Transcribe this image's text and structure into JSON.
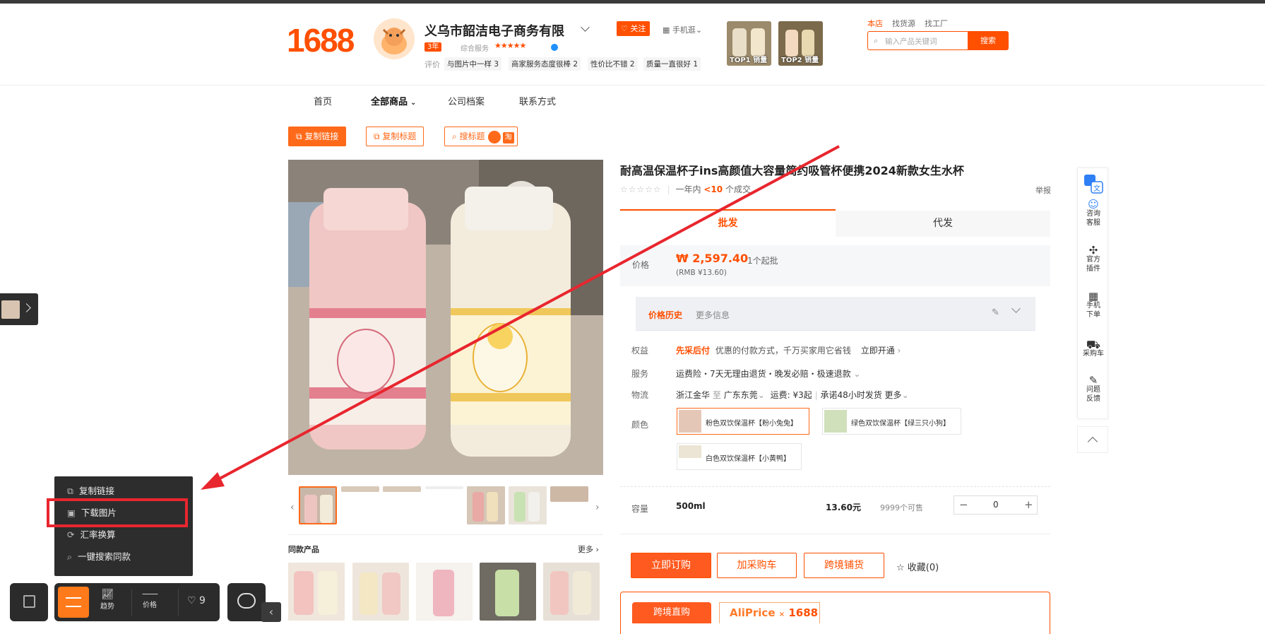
{
  "header": {
    "logo": "1688",
    "shop_name": "义乌市韶洁电子商务有限",
    "year_badge": "3年",
    "service_label": "综合服务",
    "stars": "★★★★★",
    "eval_label": "评价",
    "eval_tags": [
      "与图片中一样 3",
      "商家服务态度很棒 2",
      "性价比不错 2",
      "质量一直很好 1"
    ],
    "follow_label": "关注",
    "mobile_label": "手机逛",
    "top_images": [
      "TOP1 销量",
      "TOP2 销量"
    ],
    "search_tabs": [
      "本店",
      "找货源",
      "找工厂"
    ],
    "search_placeholder": "输入产品关键词",
    "search_button": "搜索"
  },
  "nav": [
    "首页",
    "全部商品",
    "公司档案",
    "联系方式"
  ],
  "toolbar": {
    "copy_link": "复制链接",
    "copy_title": "复制标题",
    "search_title": "搜标题",
    "tao": "淘"
  },
  "product": {
    "title": "耐高温保温杯子ins高颜值大容量简约吸管杯便携2024新款女生水杯",
    "rating_stars": "☆☆☆☆☆",
    "sales_prefix": "一年内",
    "sales_count": "<10",
    "sales_suffix": "个成交",
    "report": "举报",
    "tabs": [
      "批发",
      "代发"
    ],
    "price_label": "价格",
    "price": "₩ 2,597.40",
    "min_order": "1个起批",
    "rmb": "(RMB ¥13.60)",
    "history_tab": "价格历史",
    "more_info": "更多信息",
    "benefit_label": "权益",
    "benefit_highlight": "先采后付",
    "benefit_text": "优惠的付款方式，千万买家用它省钱",
    "benefit_link": "立即开通",
    "service_label": "服务",
    "service_text": "运费险・7天无理由退货・晚发必赔・极速退款",
    "logistics_label": "物流",
    "logistics_from": "浙江金华",
    "logistics_to_word": "至",
    "logistics_to": "广东东莞",
    "logistics_fee": "运费: ¥3起",
    "logistics_promise": "承诺48小时发货",
    "logistics_more": "更多",
    "color_label": "颜色",
    "colors": [
      "粉色双饮保温杯【粉小兔兔】",
      "绿色双饮保温杯【绿三只小狗】",
      "白色双饮保温杯【小黄鸭】"
    ],
    "capacity_label": "容量",
    "capacity_value": "500ml",
    "capacity_price": "13.60元",
    "stock": "9999个可售",
    "qty": "0",
    "buy_now": "立即订购",
    "add_cart": "加采购车",
    "cross_border": "跨境铺货",
    "favorite": "收藏(0)",
    "cross_tab": "跨境直购",
    "aliprice": "AliPrice",
    "aliprice_x": "×",
    "aliprice_1688": "1688"
  },
  "gallery": {
    "same_title": "同款产品",
    "more": "更多"
  },
  "side_panel": [
    "咨询客服",
    "官方插件",
    "手机下单",
    "采购车",
    "问题反馈"
  ],
  "ext_menu": [
    "复制链接",
    "下载图片",
    "汇率换算",
    "一键搜索同款"
  ],
  "bottom_bar": {
    "trend": "趋势",
    "price": "价格",
    "likes": "9"
  },
  "colors": {
    "accent": "#ff4f00",
    "highlight_red": "#e8262e"
  }
}
